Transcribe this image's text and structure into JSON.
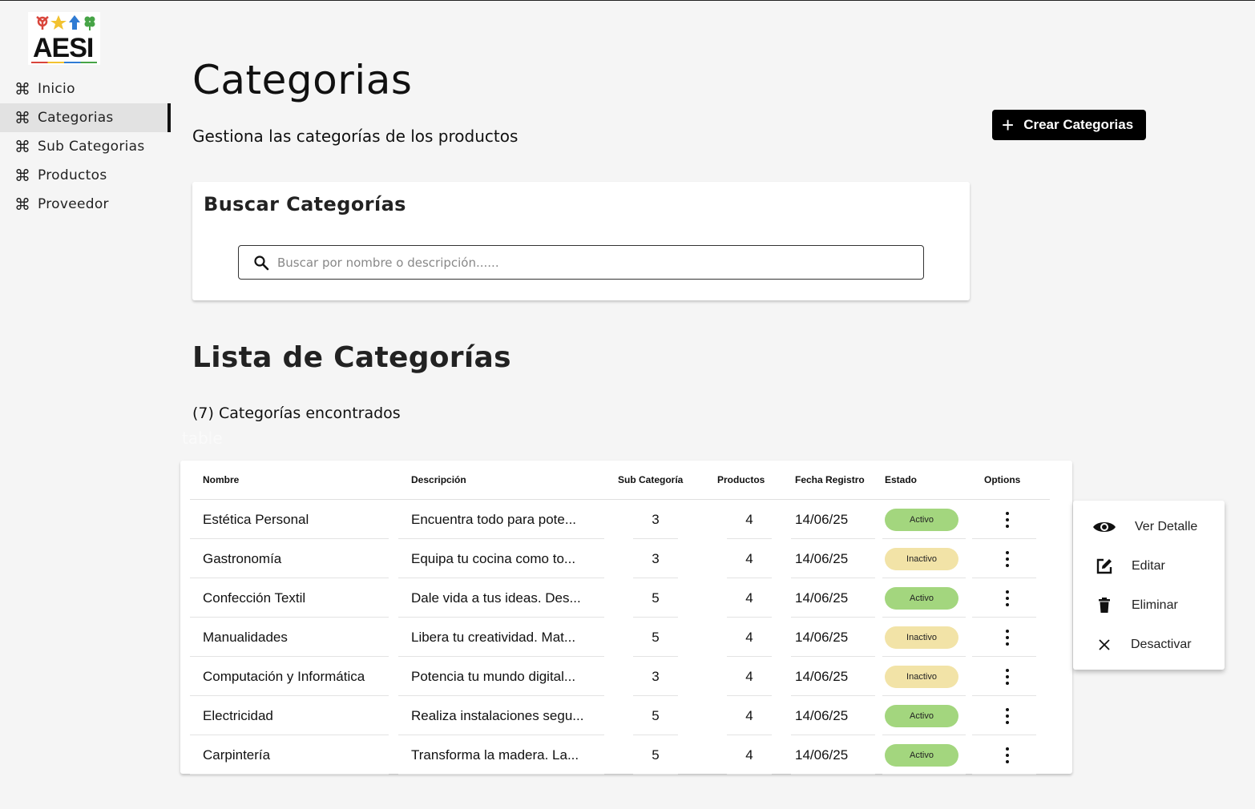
{
  "brand": {
    "logo_text": "AESI"
  },
  "sidebar": {
    "items": [
      {
        "label": "Inicio",
        "icon": "command-icon",
        "active": false
      },
      {
        "label": "Categorias",
        "icon": "command-icon",
        "active": true
      },
      {
        "label": "Sub Categorias",
        "icon": "command-icon",
        "active": false
      },
      {
        "label": "Productos",
        "icon": "command-icon",
        "active": false
      },
      {
        "label": "Proveedor",
        "icon": "command-icon",
        "active": false
      }
    ]
  },
  "header": {
    "title": "Categorias",
    "subtitle": "Gestiona las categorías de los productos",
    "create_label": "Crear Categorias"
  },
  "search": {
    "title": "Buscar Categorías",
    "placeholder": "Buscar por nombre o descripción......",
    "value": ""
  },
  "list": {
    "title": "Lista de Categorías",
    "count_text": "(7) Categorías encontrados",
    "ghost_label": "table"
  },
  "table": {
    "columns": [
      "Nombre",
      "Descripción",
      "Sub Categoría",
      "Productos",
      "Fecha Registro",
      "Estado",
      "Options"
    ],
    "rows": [
      {
        "nombre": "Estética Personal",
        "descripcion": "Encuentra todo para pote...",
        "sub": "3",
        "productos": "4",
        "fecha": "14/06/25",
        "estado": "Activo"
      },
      {
        "nombre": "Gastronomía",
        "descripcion": "Equipa tu cocina como to...",
        "sub": "3",
        "productos": "4",
        "fecha": "14/06/25",
        "estado": "Inactivo"
      },
      {
        "nombre": "Confección Textil",
        "descripcion": "Dale vida a tus ideas. Des...",
        "sub": "5",
        "productos": "4",
        "fecha": "14/06/25",
        "estado": "Activo"
      },
      {
        "nombre": "Manualidades",
        "descripcion": "Libera tu creatividad. Mat...",
        "sub": "5",
        "productos": "4",
        "fecha": "14/06/25",
        "estado": "Inactivo"
      },
      {
        "nombre": "Computación y Informática",
        "descripcion": "Potencia tu mundo digital...",
        "sub": "3",
        "productos": "4",
        "fecha": "14/06/25",
        "estado": "Inactivo"
      },
      {
        "nombre": "Electricidad",
        "descripcion": "Realiza instalaciones segu...",
        "sub": "5",
        "productos": "4",
        "fecha": "14/06/25",
        "estado": "Activo"
      },
      {
        "nombre": "Carpintería",
        "descripcion": "Transforma la madera. La...",
        "sub": "5",
        "productos": "4",
        "fecha": "14/06/25",
        "estado": "Activo"
      }
    ]
  },
  "menu": {
    "items": [
      {
        "label": "Ver Detalle",
        "icon": "eye-icon"
      },
      {
        "label": "Editar",
        "icon": "edit-icon"
      },
      {
        "label": "Eliminar",
        "icon": "trash-icon"
      },
      {
        "label": "Desactivar",
        "icon": "close-icon"
      }
    ]
  },
  "colors": {
    "activo": "#a3d67e",
    "inactivo": "#f2e3a7",
    "primary_button": "#000000"
  }
}
